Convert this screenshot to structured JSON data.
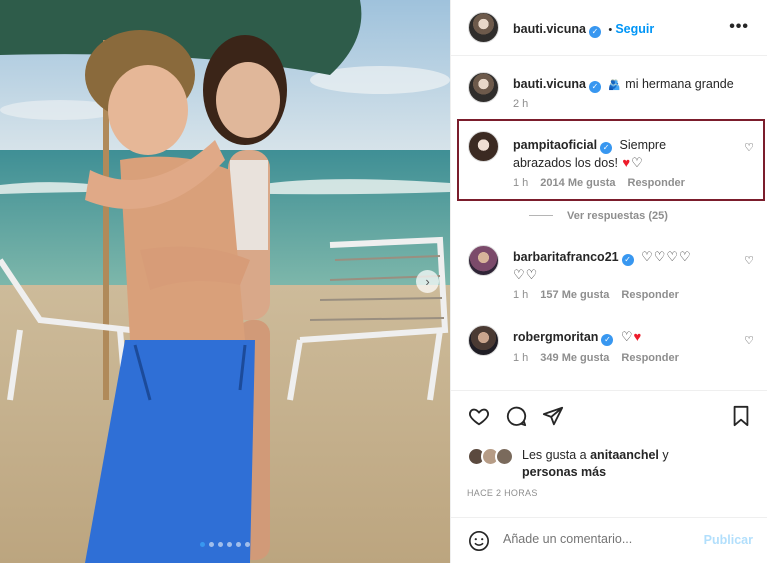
{
  "post": {
    "username": "bauti.vicuna",
    "follow_label": "Seguir",
    "more_label": "•••"
  },
  "caption": {
    "username": "bauti.vicuna",
    "text": "mi hermana grande",
    "time": "2 h"
  },
  "comments": [
    {
      "username": "pampitaoficial",
      "text_line1": "Siempre",
      "text_line2": "abrazados los dos!",
      "emojis_before": "",
      "time": "1 h",
      "likes": "2014 Me gusta",
      "reply": "Responder"
    },
    {
      "username": "barbaritafranco21",
      "time": "1 h",
      "likes": "157 Me gusta",
      "reply": "Responder"
    },
    {
      "username": "robergmoritan",
      "time": "1 h",
      "likes": "349 Me gusta",
      "reply": "Responder"
    }
  ],
  "view_replies": "Ver respuestas (25)",
  "likes": {
    "prefix": "Les gusta a ",
    "user": "anitaanchel",
    "suffix": " y",
    "others": "personas más"
  },
  "timeago": "HACE 2 HORAS",
  "comment_box": {
    "placeholder": "Añade un comentario...",
    "publish": "Publicar"
  },
  "carousel": {
    "dot_count": 6,
    "active_index": 0
  },
  "colors": {
    "accent": "#0095f6",
    "verified": "#3897f0",
    "highlight_border": "#7b1d2c",
    "heart_red": "#ed1c2b"
  }
}
